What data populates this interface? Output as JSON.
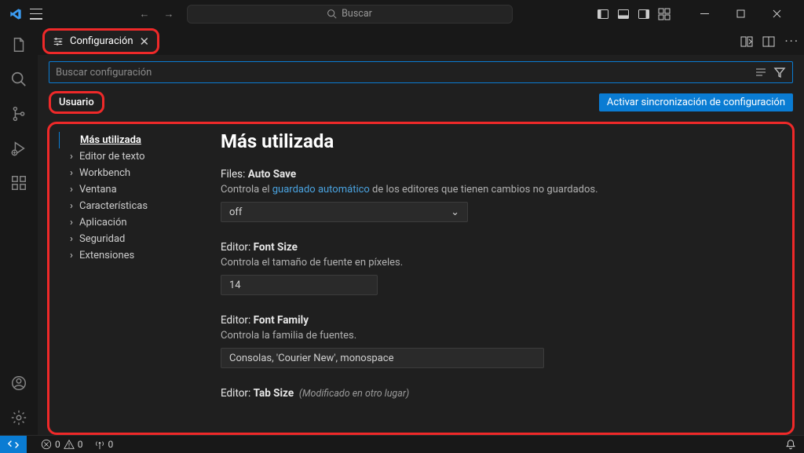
{
  "titlebar": {
    "search_placeholder": "Buscar"
  },
  "tab": {
    "label": "Configuración"
  },
  "settings_search": {
    "placeholder": "Buscar configuración"
  },
  "scope": {
    "tab_label": "Usuario",
    "sync_button": "Activar sincronización de configuración"
  },
  "tree": {
    "active": "Más utilizada",
    "items": [
      "Editor de texto",
      "Workbench",
      "Ventana",
      "Características",
      "Aplicación",
      "Seguridad",
      "Extensiones"
    ]
  },
  "content": {
    "heading": "Más utilizada",
    "settings": [
      {
        "prefix": "Files: ",
        "name": "Auto Save",
        "desc_pre": "Controla el ",
        "desc_link": "guardado automático",
        "desc_post": " de los editores que tienen cambios no guardados.",
        "control": "select",
        "value": "off"
      },
      {
        "prefix": "Editor: ",
        "name": "Font Size",
        "desc": "Controla el tamaño de fuente en píxeles.",
        "control": "text",
        "value": "14"
      },
      {
        "prefix": "Editor: ",
        "name": "Font Family",
        "desc": "Controla la familia de fuentes.",
        "control": "text-wide",
        "value": "Consolas, 'Courier New', monospace"
      },
      {
        "prefix": "Editor: ",
        "name": "Tab Size",
        "modified": "(Modificado en otro lugar)"
      }
    ]
  },
  "statusbar": {
    "errors": "0",
    "warnings": "0",
    "ports": "0"
  }
}
